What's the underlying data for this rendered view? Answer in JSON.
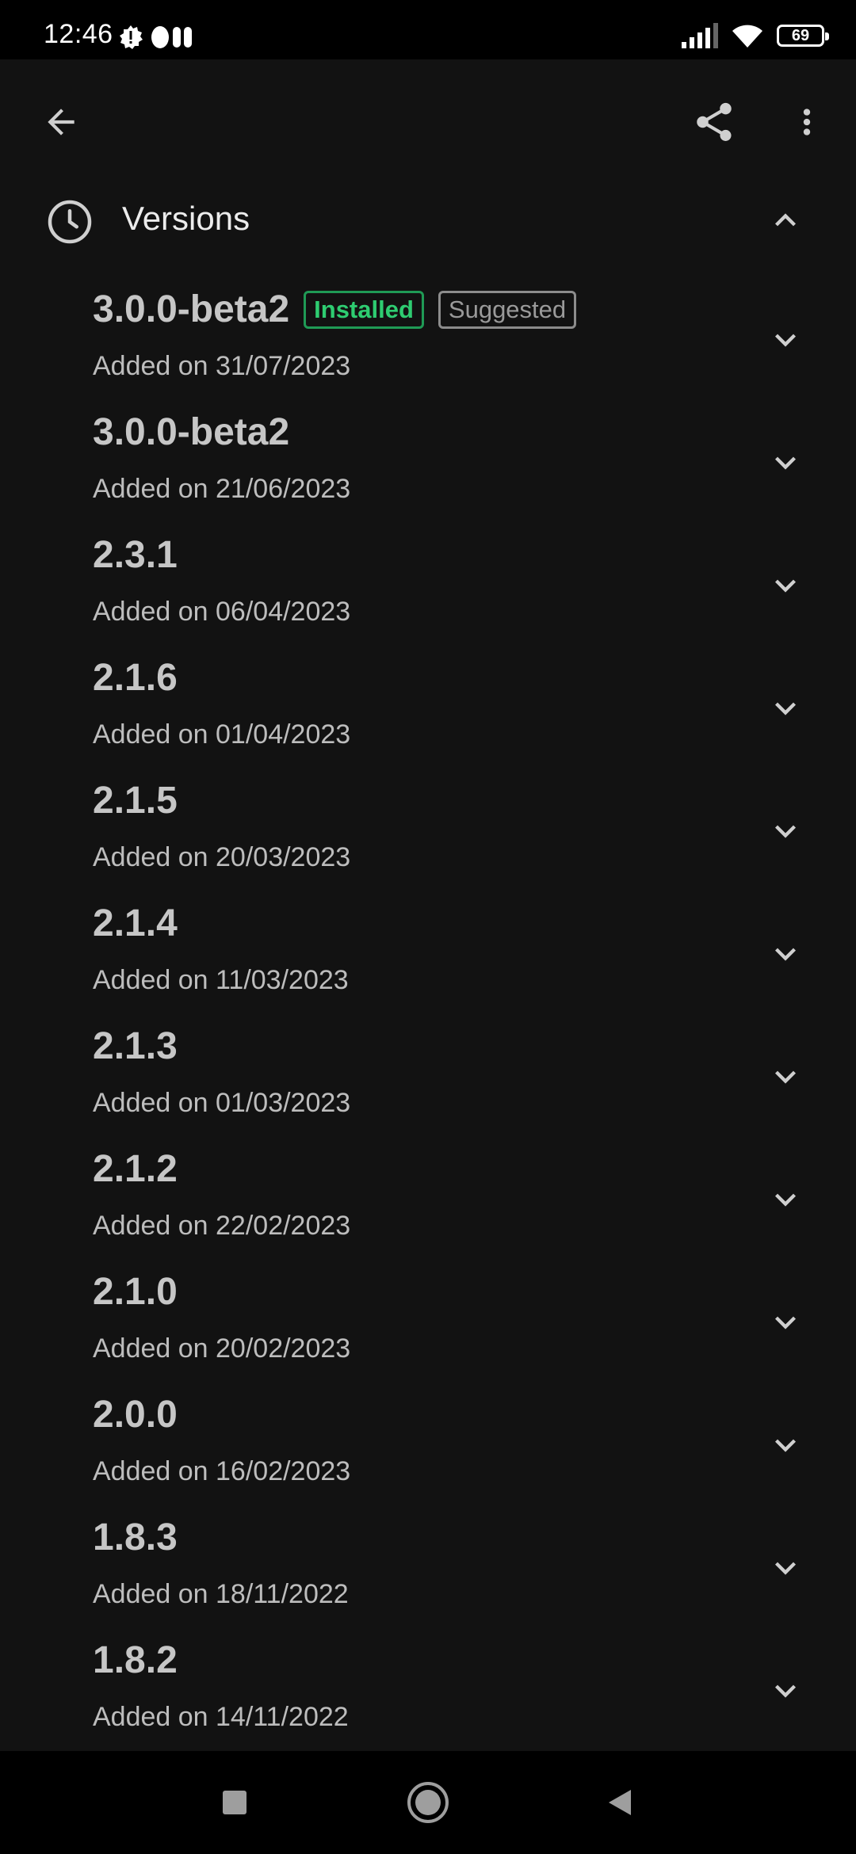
{
  "status_bar": {
    "time": "12:46",
    "battery": "69"
  },
  "header": {
    "icons": [
      "back-arrow-icon",
      "share-icon",
      "more-vert-icon"
    ]
  },
  "section": {
    "title": "Versions",
    "icon": "history-icon",
    "expanded": true
  },
  "versions": [
    {
      "name": "3.0.0-beta2",
      "date": "Added on 31/07/2023",
      "badges": [
        "Installed",
        "Suggested"
      ]
    },
    {
      "name": "3.0.0-beta2",
      "date": "Added on 21/06/2023"
    },
    {
      "name": "2.3.1",
      "date": "Added on 06/04/2023"
    },
    {
      "name": "2.1.6",
      "date": "Added on 01/04/2023"
    },
    {
      "name": "2.1.5",
      "date": "Added on 20/03/2023"
    },
    {
      "name": "2.1.4",
      "date": "Added on 11/03/2023"
    },
    {
      "name": "2.1.3",
      "date": "Added on 01/03/2023"
    },
    {
      "name": "2.1.2",
      "date": "Added on 22/02/2023"
    },
    {
      "name": "2.1.0",
      "date": "Added on 20/02/2023"
    },
    {
      "name": "2.0.0",
      "date": "Added on 16/02/2023"
    },
    {
      "name": "1.8.3",
      "date": "Added on 18/11/2022"
    },
    {
      "name": "1.8.2",
      "date": "Added on 14/11/2022"
    }
  ],
  "colors": {
    "background": "#121212",
    "installed_badge": "#2ecc71",
    "suggested_badge": "#9a9a9a"
  }
}
